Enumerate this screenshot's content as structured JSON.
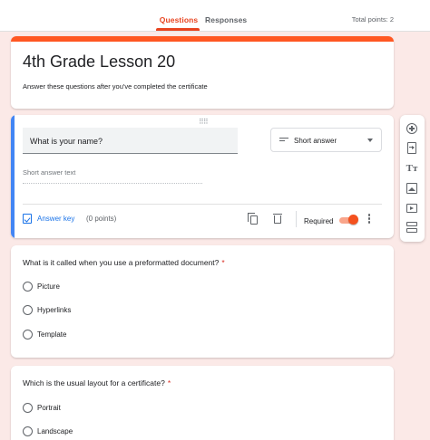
{
  "header": {
    "tabs": [
      {
        "label": "Questions",
        "active": true
      },
      {
        "label": "Responses",
        "active": false
      }
    ],
    "total_points": "Total points: 2"
  },
  "colors": {
    "accent": "#ff5722",
    "active_tab": "#e8431f",
    "page_background": "#fbe9e7",
    "selected_card_bar": "#4285f4",
    "required_star": "#d93025"
  },
  "form": {
    "title": "4th Grade Lesson 20",
    "description": "Answer these questions after you've completed the certificate"
  },
  "active_question": {
    "title": "What is your name?",
    "type": "Short answer",
    "short_answer_placeholder": "Short answer text",
    "answer_key_label": "Answer key",
    "points": "(0 points)",
    "required_label": "Required",
    "required_on": true
  },
  "questions": [
    {
      "title": "What is it called when you use a preformatted document?",
      "required_mark": "*",
      "options": [
        "Picture",
        "Hyperlinks",
        "Template"
      ]
    },
    {
      "title": "Which is the usual layout for a certificate?",
      "required_mark": "*",
      "options": [
        "Portrait",
        "Landscape"
      ]
    }
  ],
  "toolbar": {
    "icons": [
      "add-question-icon",
      "import-questions-icon",
      "add-title-icon",
      "add-image-icon",
      "add-video-icon",
      "add-section-icon"
    ],
    "title_glyph": "Tт"
  }
}
